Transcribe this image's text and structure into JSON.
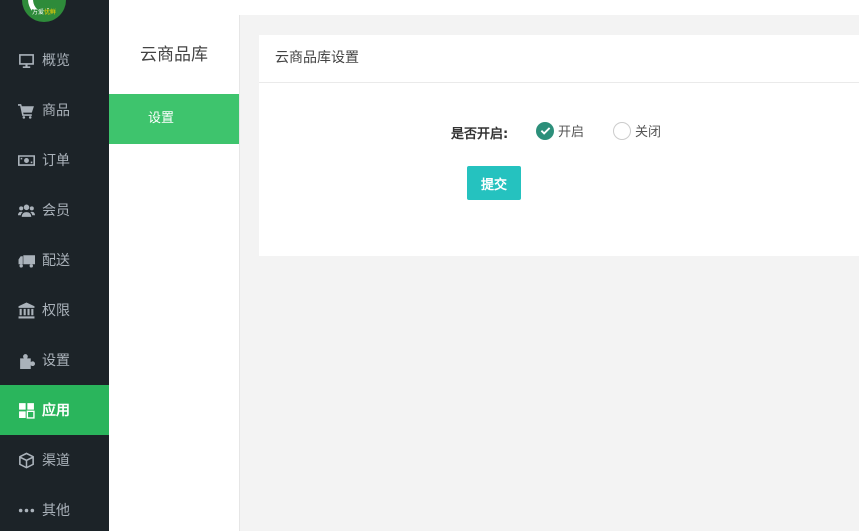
{
  "logo": {
    "text_a": "万爱",
    "text_b": "优鲜"
  },
  "sidebar": {
    "items": [
      {
        "label": "概览",
        "icon": "monitor-icon"
      },
      {
        "label": "商品",
        "icon": "cart-icon"
      },
      {
        "label": "订单",
        "icon": "money-icon"
      },
      {
        "label": "会员",
        "icon": "users-icon"
      },
      {
        "label": "配送",
        "icon": "truck-icon"
      },
      {
        "label": "权限",
        "icon": "bank-icon"
      },
      {
        "label": "设置",
        "icon": "puzzle-icon"
      },
      {
        "label": "应用",
        "icon": "apps-icon",
        "active": true
      },
      {
        "label": "渠道",
        "icon": "cube-icon"
      },
      {
        "label": "其他",
        "icon": "ellipsis-icon"
      }
    ]
  },
  "subnav": {
    "title": "云商品库",
    "items": [
      {
        "label": "设置",
        "active": true
      }
    ]
  },
  "panel": {
    "title": "云商品库设置",
    "field_label": "是否开启:",
    "options": [
      {
        "label": "开启",
        "checked": true
      },
      {
        "label": "关闭",
        "checked": false
      }
    ],
    "submit_label": "提交"
  },
  "colors": {
    "sidebar_bg": "#1c2328",
    "active_green": "#2ab55c",
    "subnav_active": "#3ec46d",
    "radio_checked": "#2c8f7a",
    "submit_bg": "#25c2bf"
  }
}
